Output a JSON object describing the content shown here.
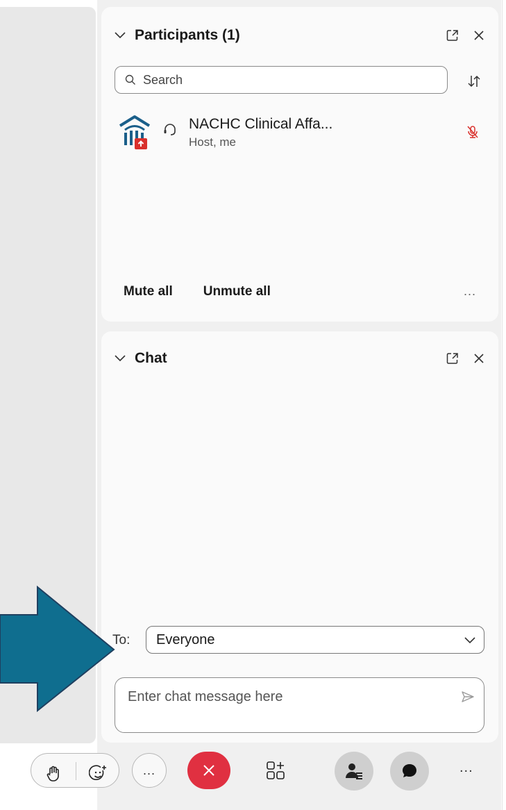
{
  "participants_panel": {
    "title": "Participants (1)",
    "search": {
      "placeholder": "Search",
      "value": ""
    },
    "participants": [
      {
        "name": "NACHC Clinical Affa...",
        "role": "Host, me",
        "mic_status": "muted"
      }
    ],
    "footer": {
      "mute_all_label": "Mute all",
      "unmute_all_label": "Unmute all",
      "more_label": "..."
    }
  },
  "chat_panel": {
    "title": "Chat",
    "to_label": "To:",
    "recipient": "Everyone",
    "message": {
      "placeholder": "Enter chat message here",
      "value": ""
    }
  },
  "toolbar": {
    "more_label": "...",
    "overflow_label": "..."
  },
  "icons": [
    "chevron-down-icon",
    "popout-icon",
    "close-icon",
    "search-icon",
    "sort-icon",
    "org-avatar-icon",
    "headset-icon",
    "mic-muted-icon",
    "send-icon",
    "raise-hand-icon",
    "reactions-icon",
    "more-icon",
    "leave-icon",
    "apps-icon",
    "participants-icon",
    "chat-icon",
    "arrow-pointer-icon"
  ],
  "colors": {
    "leave_red": "#e03041",
    "muted_red": "#d9302c",
    "arrow_fill": "#0f6e8f",
    "arrow_stroke": "#1f4060",
    "avatar_blue": "#1a5f8a",
    "panel_bg": "#fafafa"
  }
}
